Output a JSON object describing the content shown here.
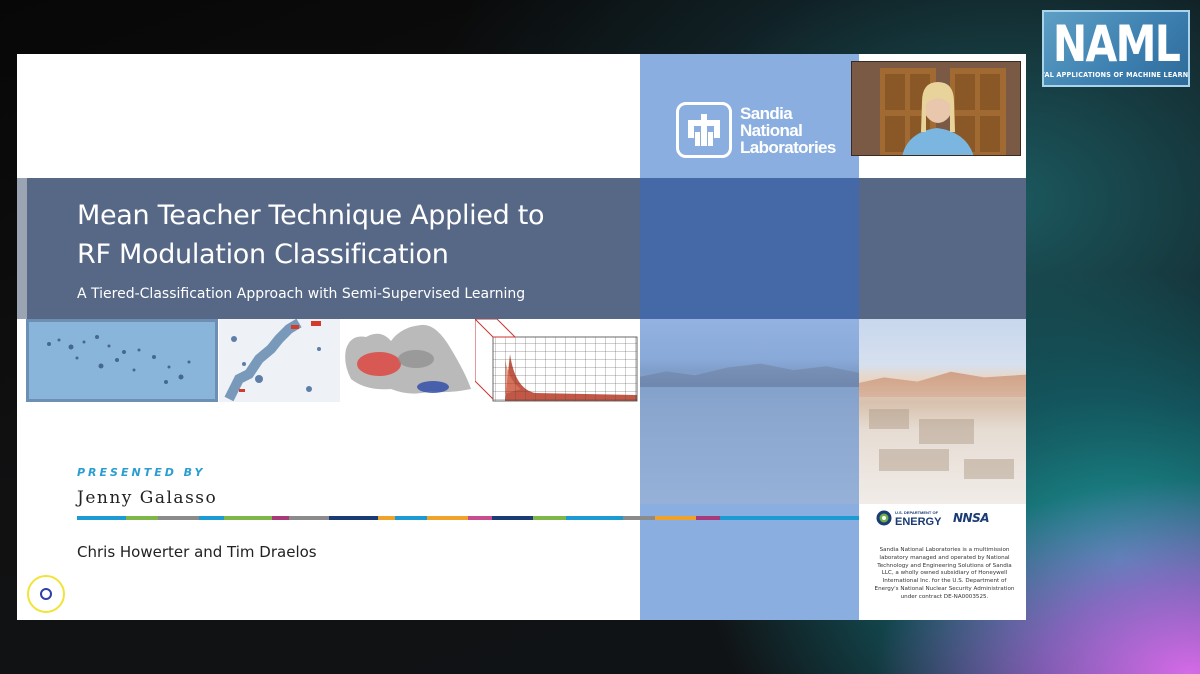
{
  "naml_logo": {
    "title": "NAML",
    "subtitle": "NAVAL APPLICATIONS OF MACHINE LEARNING"
  },
  "slide": {
    "title_line1": "Mean Teacher Technique Applied to",
    "title_line2": "RF Modulation Classification",
    "subtitle": "A Tiered-Classification Approach with Semi-Supervised Learning",
    "presented_by_label": "PRESENTED BY",
    "presenter": "Jenny Galasso",
    "coauthors": "Chris Howerter and Tim Draelos",
    "org_logo": {
      "line1": "Sandia",
      "line2": "National",
      "line3": "Laboratories"
    },
    "doe_logo": {
      "small": "U.S. DEPARTMENT OF",
      "big": "ENERGY"
    },
    "nnsa_logo": "NNSA",
    "disclaimer": "Sandia National Laboratories is a multimission laboratory managed and operated by National Technology and Engineering Solutions of Sandia LLC, a wholly owned subsidiary of Honeywell International Inc. for the U.S. Department of Energy's National Nuclear Security Administration under contract DE-NA0003525."
  },
  "colors": {
    "title_band": "#495d7d",
    "accent_blue": "#2a9ed1",
    "org_blue": "#8aaee0",
    "color_bar": [
      "#1b9bd1",
      "#7fb64a",
      "#8b8b8b",
      "#1b9bd1",
      "#7fb64a",
      "#a8397b",
      "#8b8b8b",
      "#1a3b73",
      "#f0a32b",
      "#1b9bd1",
      "#f0a32b",
      "#c74d8e",
      "#1a3b73",
      "#7fb64a",
      "#1b9bd1",
      "#8b8b8b",
      "#f0a32b",
      "#a8397b",
      "#1b9bd1"
    ]
  },
  "icons": {
    "sandia": "sandia-thunderbird-icon",
    "doe": "doe-seal-icon",
    "cursor": "cursor-ring-icon"
  }
}
